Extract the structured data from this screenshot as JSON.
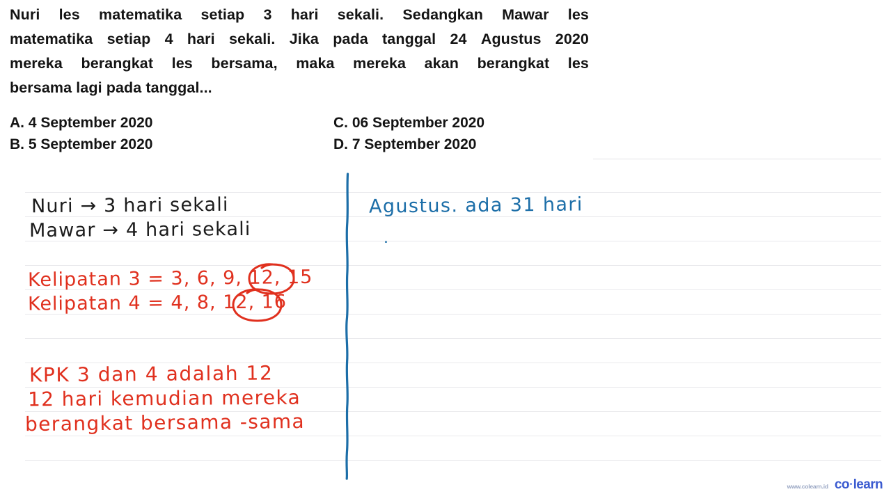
{
  "question": {
    "lines": [
      [
        "Nuri",
        "les",
        "matematika",
        "setiap",
        "3",
        "hari",
        "sekali.",
        "Sedangkan",
        "Mawar",
        "les"
      ],
      [
        "matematika",
        "setiap",
        "4",
        "hari",
        "sekali.",
        "Jika",
        "pada",
        "tanggal",
        "24",
        "Agustus",
        "2020"
      ],
      [
        "mereka",
        "berangkat",
        "les",
        "bersama,",
        "maka",
        "mereka",
        "akan",
        "berangkat",
        "les"
      ]
    ],
    "last_line": "bersama lagi pada tanggal..."
  },
  "options": [
    {
      "a": "A. 4 September 2020",
      "b": "C. 06 September 2020"
    },
    {
      "a": "B. 5 September 2020",
      "b": "D. 7 September 2020"
    }
  ],
  "handwriting": {
    "left_column": [
      {
        "text": "Nuri → 3 hari sekali",
        "color": "black"
      },
      {
        "text": "Mawar → 4 hari sekali",
        "color": "black"
      },
      {
        "text": "Kelipatan 3 = 3, 6, 9, 12, 15",
        "color": "red"
      },
      {
        "text": "Kelipatan 4 = 4, 8, 12, 16",
        "color": "red"
      },
      {
        "text": "KPK 3 dan 4 adalah 12",
        "color": "red"
      },
      {
        "text": "12 hari kemudian mereka",
        "color": "red"
      },
      {
        "text": "berangkat bersama -sama",
        "color": "red"
      }
    ],
    "right_column": [
      {
        "text": "Agustus. ada 31 hari",
        "color": "blue"
      },
      {
        "text": ".",
        "color": "blue"
      }
    ],
    "circled_values": [
      "12",
      "12"
    ]
  },
  "colors": {
    "red_ink": "#e0301e",
    "blue_ink": "#1c6ea8",
    "black_ink": "#1c1c1c",
    "rule_line": "#e9e9ec",
    "logo_blue": "#3b5bd0"
  },
  "logo": {
    "url": "www.colearn.id",
    "word_prefix": "co",
    "word_dot": "·",
    "word_suffix": "learn"
  }
}
